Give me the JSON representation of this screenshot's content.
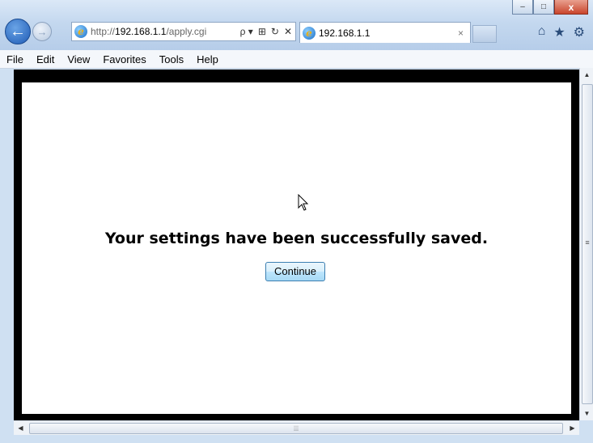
{
  "browser": {
    "address": {
      "prefix": "http://",
      "host": "192.168.1.1",
      "path": "/apply.cgi",
      "tools": [
        "ρ ▾",
        "⊞",
        "↻",
        "✕"
      ]
    },
    "tab": {
      "title": "192.168.1.1",
      "close": "×"
    },
    "window_controls": {
      "minimize": "–",
      "maximize": "□",
      "close": "x"
    },
    "right_icons": {
      "home": "⌂",
      "favorites": "★",
      "tools": "⚙"
    }
  },
  "menu": {
    "items": [
      "File",
      "Edit",
      "View",
      "Favorites",
      "Tools",
      "Help"
    ]
  },
  "page": {
    "message": "Your settings have been successfully saved.",
    "continue_label": "Continue"
  },
  "scrollbars": {
    "vertical_grip": "≡",
    "horizontal_grip": "⦙⦙⦙"
  },
  "colors": {
    "frame_border": "#000000",
    "button_border": "#3c7fb1",
    "chrome": "#cfe0f2"
  }
}
